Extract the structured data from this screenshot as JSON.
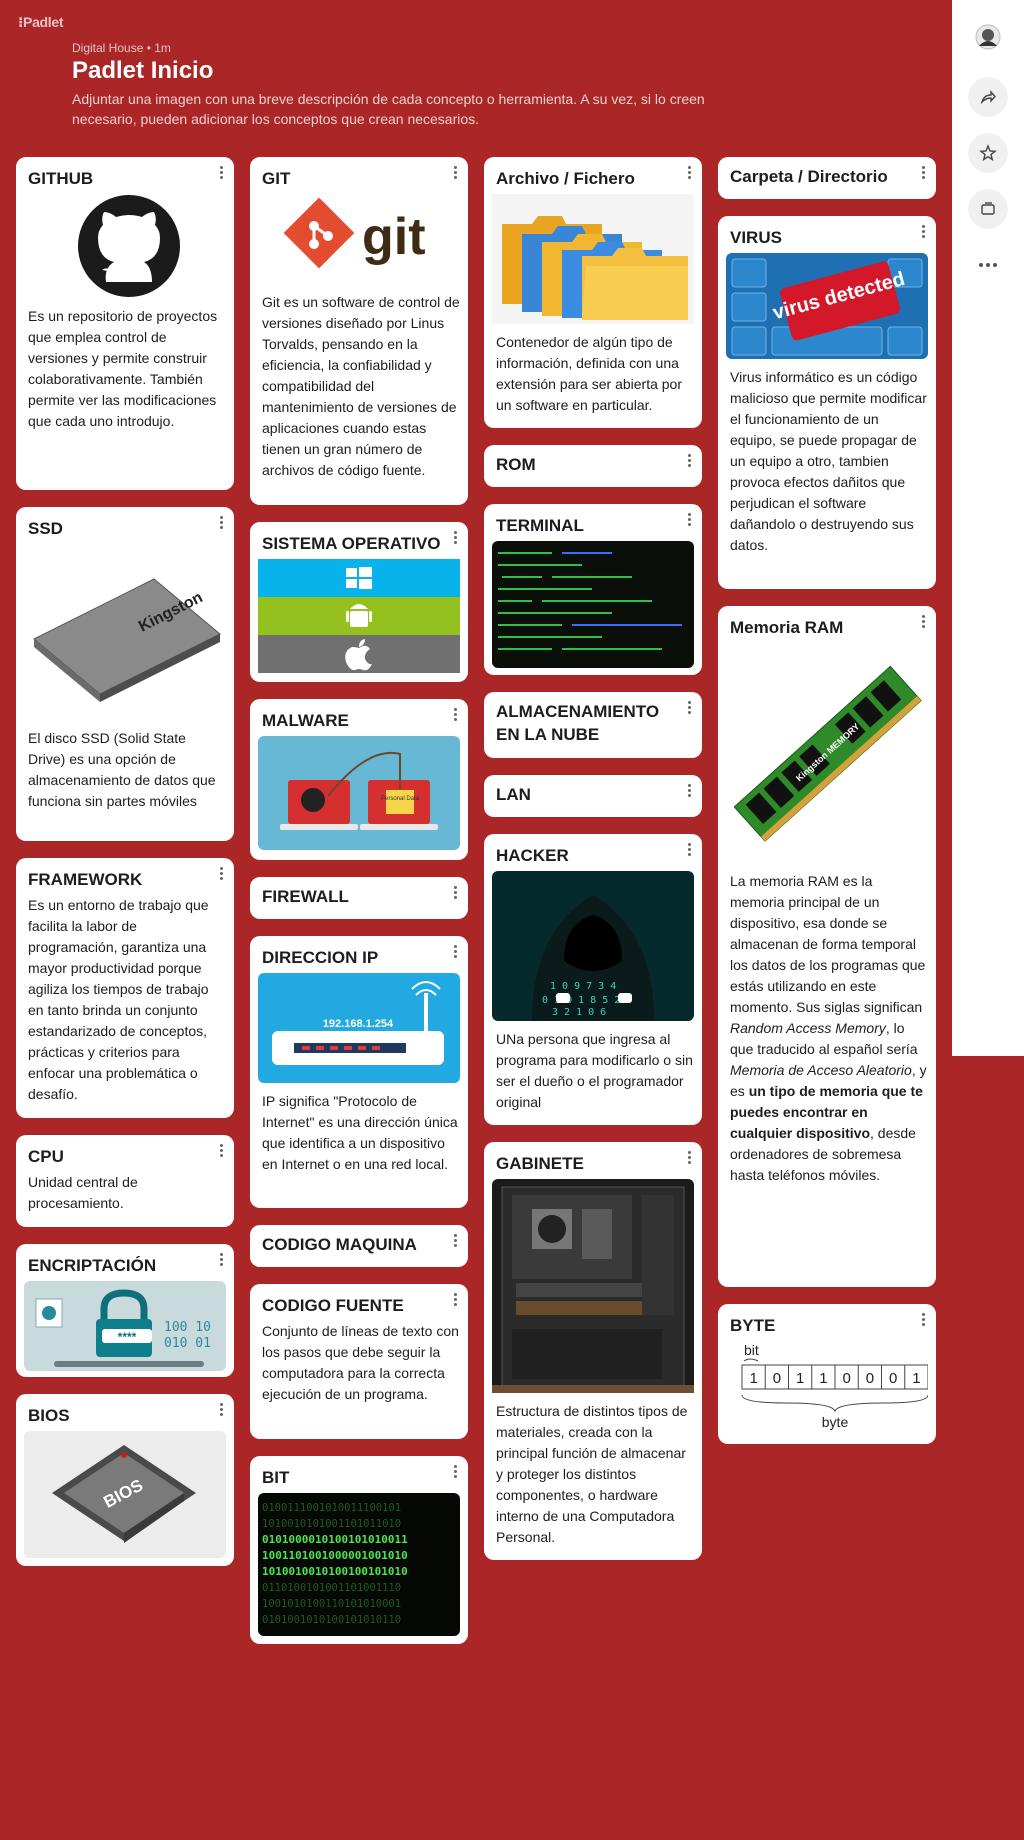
{
  "header": {
    "logo": "Padlet",
    "breadcrumb": "Digital House • 1m",
    "title": "Padlet Inicio",
    "description": "Adjuntar una imagen con una breve descripción de cada concepto o herramienta. A su vez, si lo creen necesario, pueden adicionar los conceptos que crean necesarios."
  },
  "sidebar": {
    "icons": [
      "avatar",
      "share-icon",
      "star-icon",
      "remake-icon",
      "more-icon"
    ]
  },
  "colors": {
    "background": "#ab2727",
    "card": "#ffffff"
  },
  "cards": {
    "github": {
      "title": "GITHUB",
      "text": "Es un repositorio de proyectos que emplea control de versiones y permite construir colaborativamente. También permite ver las modificaciones que cada uno introdujo."
    },
    "ssd": {
      "title": "SSD",
      "text": "El disco SSD (Solid State Drive) es una opción de almacenamiento de datos que funciona sin partes móviles",
      "image_text": "Kingston"
    },
    "framework": {
      "title": "FRAMEWORK",
      "text": "Es un entorno de trabajo que facilita la labor de programación, garantiza una mayor productividad porque agiliza los tiempos de trabajo en tanto brinda un conjunto estandarizado de conceptos, prácticas y criterios para enfocar una problemática o desafío."
    },
    "cpu": {
      "title": "CPU",
      "text": "Unidad central de procesamiento."
    },
    "encriptacion": {
      "title": "ENCRIPTACIÓN",
      "image_text": "****"
    },
    "bios": {
      "title": "BIOS",
      "image_text": "BIOS"
    },
    "git": {
      "title": "GIT",
      "image_text": "git",
      "text": "Git es un software de control de versiones diseñado por Linus Torvalds, pensando en la eficiencia, la confiabilidad y compatibilidad del mantenimiento de versiones de aplicaciones cuando estas tienen un gran número de archivos de código fuente."
    },
    "so": {
      "title": "SISTEMA OPERATIVO"
    },
    "malware": {
      "title": "MALWARE",
      "image_text": "Personal Data"
    },
    "firewall": {
      "title": "FIREWALL"
    },
    "ip": {
      "title": "DIRECCION IP",
      "image_text": "192.168.1.254",
      "text": "IP significa \"Protocolo de Internet\" es una dirección única que identifica a un dispositivo en Internet o en una red local."
    },
    "codigo_maquina": {
      "title": "CODIGO MAQUINA"
    },
    "codigo_fuente": {
      "title": "CODIGO FUENTE",
      "text": "Conjunto de líneas de texto con los pasos que debe seguir la computadora para la correcta ejecución de un programa."
    },
    "bit": {
      "title": "BIT"
    },
    "archivo": {
      "title": "Archivo / Fichero",
      "text": "Contenedor de algún tipo de información, definida con una extensión para ser abierta por un software en particular."
    },
    "rom": {
      "title": "ROM"
    },
    "terminal": {
      "title": "TERMINAL"
    },
    "nube": {
      "title": "ALMACENAMIENTO EN LA NUBE"
    },
    "lan": {
      "title": "LAN"
    },
    "hacker": {
      "title": "HACKER",
      "text": "UNa persona que ingresa al programa para modificarlo o sin ser el dueño o el programador original"
    },
    "gabinete": {
      "title": "GABINETE",
      "text": "Estructura de distintos tipos de materiales, creada con la principal función de almacenar y proteger los distintos componentes, o hardware interno de una Computadora Personal."
    },
    "carpeta": {
      "title": "Carpeta / Directorio"
    },
    "virus": {
      "title": "VIRUS",
      "image_text": "virus detected",
      "text": "Virus informático es un código malicioso que permite modificar el funcionamiento de un equipo, se puede propagar de un equipo a otro, tambien provoca efectos dañitos que perjudican el software dañandolo o destruyendo sus datos."
    },
    "ram": {
      "title": "Memoria RAM",
      "image_text": "Kingston MEMORY",
      "text_1": "La memoria RAM es la memoria principal de un dispositivo, esa donde se almacenan de forma temporal los datos de los programas que estás utilizando en este momento. Sus siglas significan ",
      "text_em1": "Random Access Memory",
      "text_2": ", lo que traducido al español sería ",
      "text_em2": "Memoria de Acceso Aleatorio",
      "text_3": ", y es ",
      "text_strong": "un tipo de memoria que te puedes encontrar en cualquier dispositivo",
      "text_4": ", desde ordenadores de sobremesa hasta teléfonos móviles."
    },
    "byte": {
      "title": "BYTE",
      "label_bit": "bit",
      "label_byte": "byte",
      "bits": [
        "1",
        "0",
        "1",
        "1",
        "0",
        "0",
        "0",
        "1"
      ]
    }
  }
}
